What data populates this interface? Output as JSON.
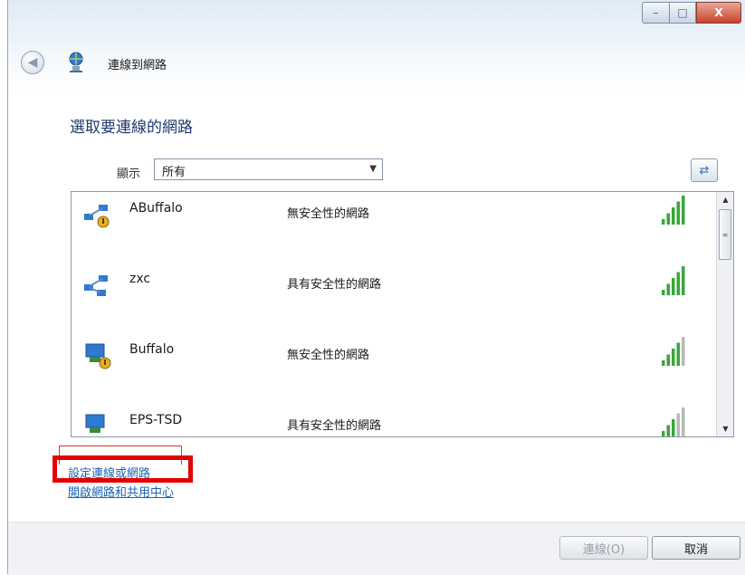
{
  "window": {
    "title": "連線到網路",
    "controls": {
      "minimize": "–",
      "maximize": "□",
      "close": "X"
    }
  },
  "header": {
    "heading": "選取要連線的網路"
  },
  "filter": {
    "label": "顯示",
    "selected": "所有"
  },
  "networks": [
    {
      "name": "ABuffalo",
      "security": "無安全性的網路",
      "signal_bars": 5,
      "icon": "adhoc-unsecured-icon"
    },
    {
      "name": "zxc",
      "security": "具有安全性的網路",
      "signal_bars": 5,
      "icon": "adhoc-network-icon"
    },
    {
      "name": "Buffalo",
      "security": "無安全性的網路",
      "signal_bars": 4,
      "icon": "wireless-unsecured-icon"
    },
    {
      "name": "EPS-TSD",
      "security": "具有安全性的網路",
      "signal_bars": 3,
      "icon": "wireless-network-icon"
    }
  ],
  "links": {
    "setup": "設定連線或網路",
    "network_center": "開啟網路和共用中心"
  },
  "buttons": {
    "connect": "連線(O)",
    "cancel": "取消"
  },
  "colors": {
    "heading": "#1f3a6e",
    "link": "#1b64b4",
    "highlight": "#e30000",
    "signal_on": "#3aa63a",
    "signal_off": "#b8b8b8"
  }
}
